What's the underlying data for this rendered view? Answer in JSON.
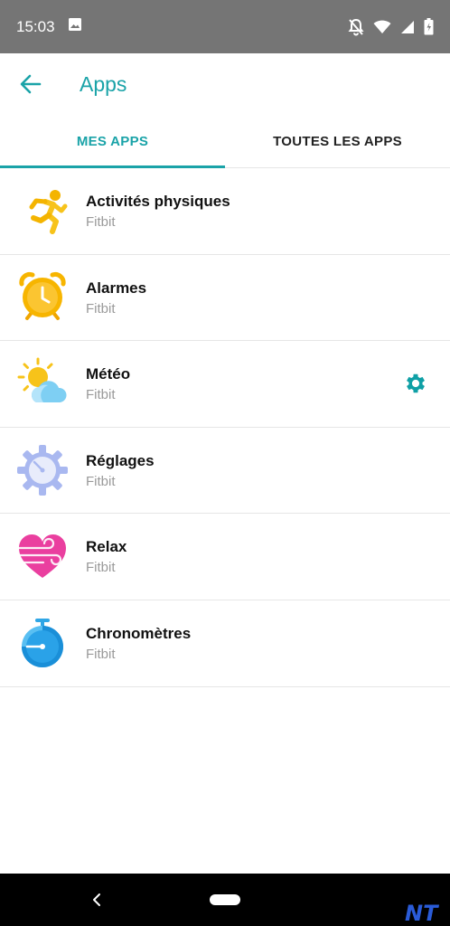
{
  "status_bar": {
    "time": "15:03",
    "icons": [
      "image-icon",
      "notifications-off-icon",
      "wifi-icon",
      "signal-icon",
      "battery-icon"
    ]
  },
  "app_bar": {
    "title": "Apps",
    "back_icon": "arrow-left-icon"
  },
  "tabs": [
    {
      "label": "MES APPS",
      "selected": true
    },
    {
      "label": "TOUTES LES APPS",
      "selected": false
    }
  ],
  "apps": [
    {
      "name": "Activités physiques",
      "developer": "Fitbit",
      "icon": "running-person-icon",
      "has_settings": false
    },
    {
      "name": "Alarmes",
      "developer": "Fitbit",
      "icon": "alarm-clock-icon",
      "has_settings": false
    },
    {
      "name": "Météo",
      "developer": "Fitbit",
      "icon": "weather-icon",
      "has_settings": true
    },
    {
      "name": "Réglages",
      "developer": "Fitbit",
      "icon": "settings-gear-icon",
      "has_settings": false
    },
    {
      "name": "Relax",
      "developer": "Fitbit",
      "icon": "heart-breath-icon",
      "has_settings": false
    },
    {
      "name": "Chronomètres",
      "developer": "Fitbit",
      "icon": "stopwatch-icon",
      "has_settings": false
    }
  ],
  "colors": {
    "accent": "#1aa3a8",
    "status_bar": "#757575",
    "nav_bar": "#000000",
    "secondary_text": "#9a9a9a"
  },
  "watermark": "NT"
}
